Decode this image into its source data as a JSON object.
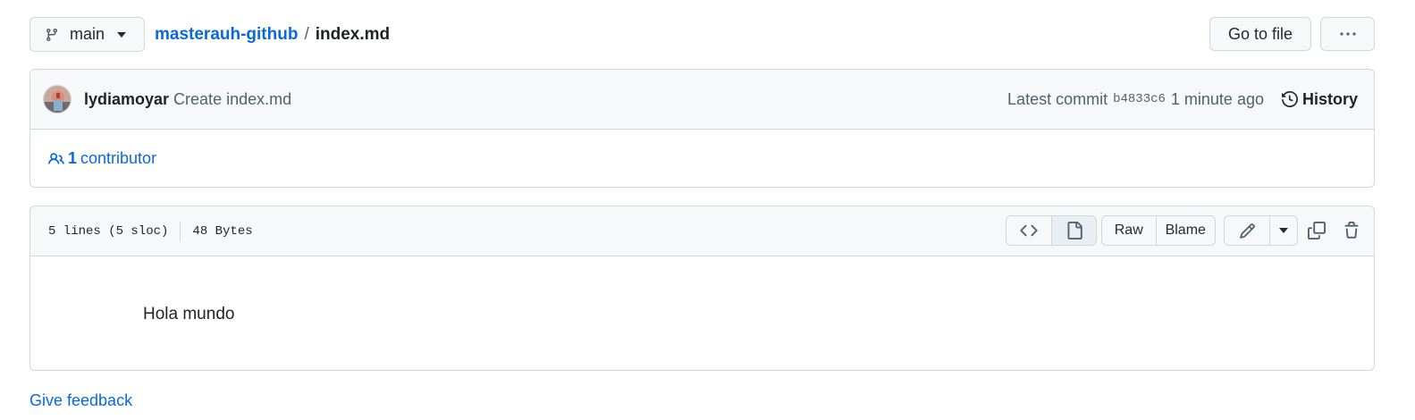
{
  "header": {
    "branch": "main",
    "repo": "masterauh-github",
    "separator": "/",
    "file": "index.md",
    "goto_label": "Go to file",
    "more_label": "···"
  },
  "commit": {
    "author": "lydiamoyar",
    "message": "Create index.md",
    "latest_label": "Latest commit",
    "sha": "b4833c6",
    "time": "1 minute ago",
    "history_label": "History",
    "contributor_count": "1",
    "contributor_label": "contributor"
  },
  "file": {
    "lines": "5 lines (5 sloc)",
    "size": "48 Bytes",
    "raw_label": "Raw",
    "blame_label": "Blame",
    "content": "Hola mundo"
  },
  "footer": {
    "feedback": "Give feedback"
  },
  "icons": {
    "branch": "git-branch-icon",
    "caret": "triangle-down-icon",
    "more": "kebab-horizontal-icon",
    "history": "history-icon",
    "contributors": "people-icon",
    "code": "code-icon",
    "file": "file-icon",
    "edit": "pencil-icon",
    "copy": "copy-icon",
    "delete": "trash-icon"
  },
  "colors": {
    "link": "#0969da",
    "text": "#1f2328",
    "muted": "#57606a",
    "border": "#d0d7de",
    "header_bg": "#f6f8fa"
  }
}
